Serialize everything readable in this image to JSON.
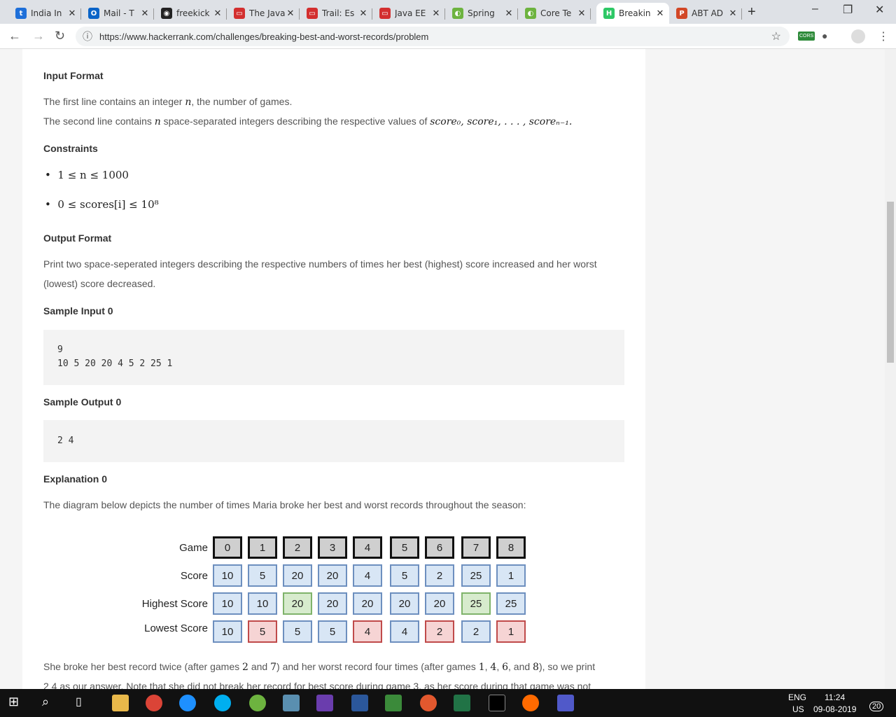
{
  "tabs": [
    {
      "label": "India In",
      "color": "#1e6fd9",
      "glyph": "t"
    },
    {
      "label": "Mail - T",
      "color": "#0a64c8",
      "glyph": "O"
    },
    {
      "label": "freekick",
      "color": "#222",
      "glyph": "◉"
    },
    {
      "label": "The Java",
      "color": "#d32f2f",
      "glyph": "▭"
    },
    {
      "label": "Trail: Es",
      "color": "#d32f2f",
      "glyph": "▭"
    },
    {
      "label": "Java EE",
      "color": "#d32f2f",
      "glyph": "▭"
    },
    {
      "label": "Spring",
      "color": "#6db33f",
      "glyph": "◐"
    },
    {
      "label": "Core Te",
      "color": "#6db33f",
      "glyph": "◐"
    },
    {
      "label": "Breakin",
      "color": "#2ec866",
      "glyph": "H"
    },
    {
      "label": "ABT AD",
      "color": "#d24726",
      "glyph": "P"
    }
  ],
  "browser": {
    "url": "https://www.hackerrank.com/challenges/breaking-best-and-worst-records/problem",
    "new_tab": "+",
    "back": "←",
    "forward": "→",
    "reload": "↻",
    "info": "ⓘ",
    "star": "☆",
    "menu": "⋮",
    "ext": "CORS"
  },
  "window": {
    "minimize": "–",
    "restore": "❐",
    "close": "✕"
  },
  "page": {
    "input_format_heading": "Input Format",
    "input_line1_a": "The first line contains an integer ",
    "n_var": "n",
    "input_line1_b": ", the number of games.",
    "input_line2_a": "The second line contains ",
    "input_line2_b": " space-separated integers describing the respective values of ",
    "scores_math": "score₀, score₁, . . . , scoreₙ₋₁.",
    "constraints_heading": "Constraints",
    "constraint1": "1 ≤ n ≤ 1000",
    "constraint2": "0 ≤ scores[i] ≤ 10⁸",
    "output_format_heading": "Output Format",
    "output_line1": "Print two space-seperated integers describing the respective numbers of times her best (highest) score increased and her worst",
    "output_line2": "(lowest) score decreased.",
    "sample_input_heading": "Sample Input 0",
    "sample_input": [
      "9",
      "10 5 20 20 4 5 2 25 1"
    ],
    "sample_output_heading": "Sample Output 0",
    "sample_output": "2 4",
    "explanation_heading": "Explanation 0",
    "explanation_text": "The diagram below depicts the number of times Maria broke her best and worst records throughout the season:",
    "final_text_a": "She broke her best record twice (after games ",
    "g2": "2",
    "final_and": " and ",
    "g7": "7",
    "final_text_b": ") and her worst record four times (after games ",
    "g1": "1",
    "comma": ", ",
    "g4": "4",
    "g6": "6",
    "and_": ", and ",
    "g8": "8",
    "final_text_c": "), so we print",
    "final_line2": "2 4 as our answer. Note that she did not break her record for best score during game 3, as her score during that game was not"
  },
  "diagram": {
    "labels": [
      "Game",
      "Score",
      "Highest Score",
      "Lowest Score"
    ],
    "games": [
      "0",
      "1",
      "2",
      "3",
      "4",
      "5",
      "6",
      "7",
      "8"
    ],
    "scores": [
      "10",
      "5",
      "20",
      "20",
      "4",
      "5",
      "2",
      "25",
      "1"
    ],
    "highest": [
      "10",
      "10",
      "20",
      "20",
      "20",
      "20",
      "20",
      "25",
      "25"
    ],
    "lowest": [
      "10",
      "5",
      "5",
      "5",
      "4",
      "4",
      "2",
      "2",
      "1"
    ],
    "highest_state": [
      "n",
      "n",
      "g",
      "n",
      "n",
      "n",
      "n",
      "g",
      "n"
    ],
    "lowest_state": [
      "n",
      "r",
      "n",
      "n",
      "r",
      "n",
      "r",
      "n",
      "r"
    ]
  },
  "taskbar": {
    "lang": "ENG",
    "region": "US",
    "time": "11:24",
    "date": "09-08-2019",
    "notifications": "20"
  }
}
